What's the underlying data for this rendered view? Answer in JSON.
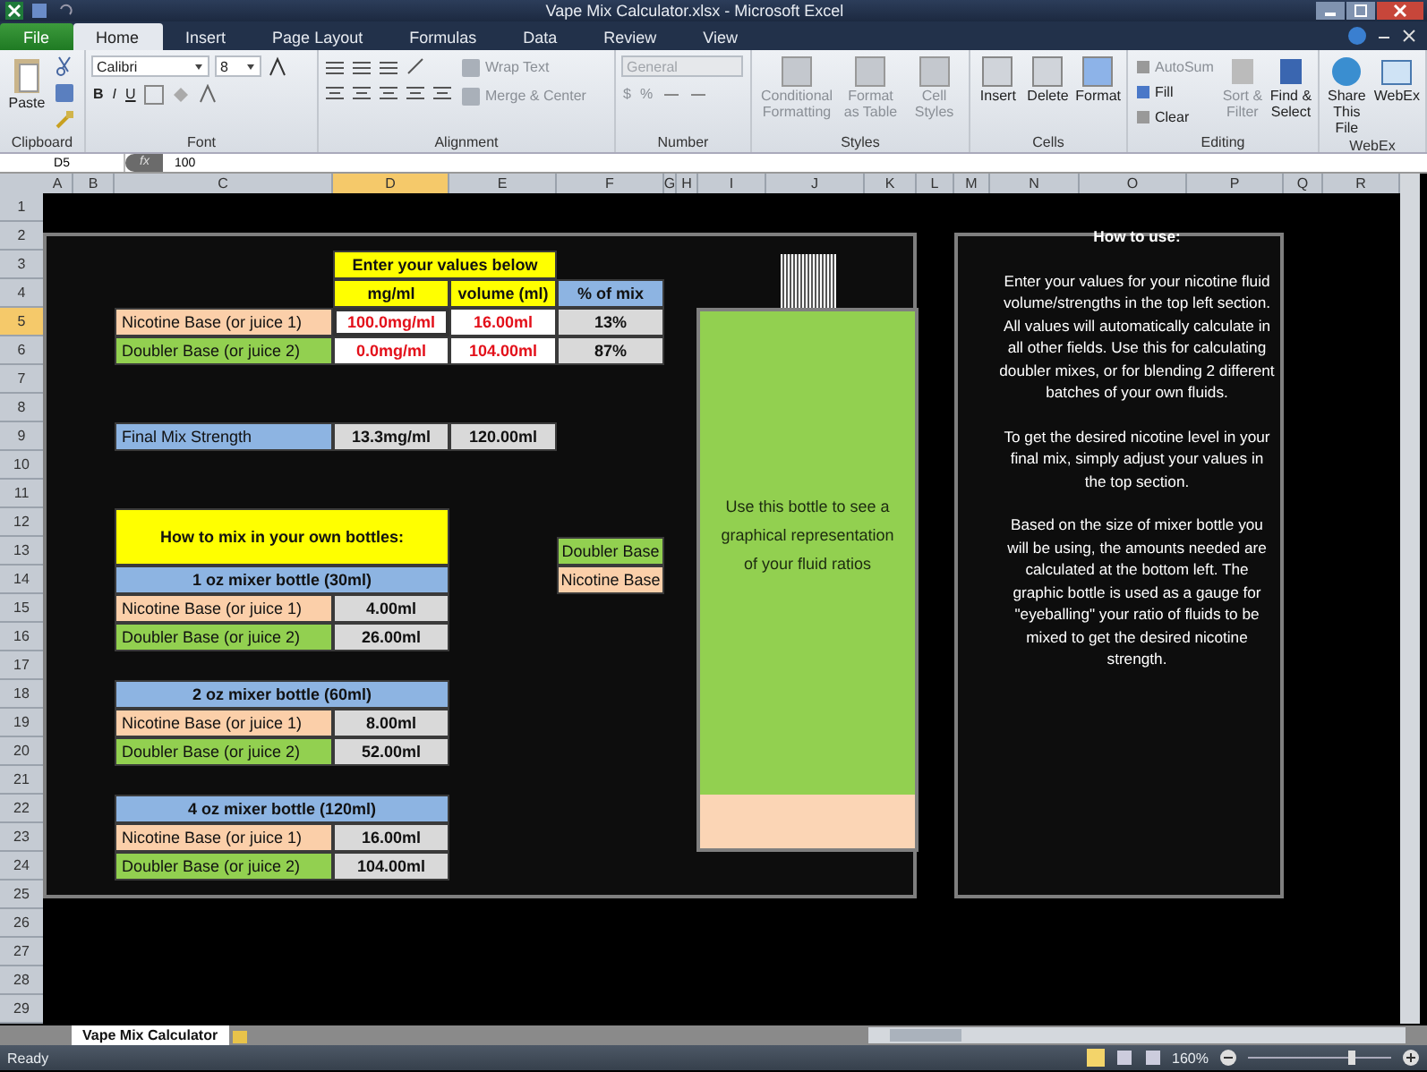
{
  "window": {
    "title": "Vape Mix Calculator.xlsx - Microsoft Excel"
  },
  "tabs": [
    {
      "label": "File",
      "kind": "file",
      "selected": false
    },
    {
      "label": "Home",
      "kind": "tab",
      "selected": true
    },
    {
      "label": "Insert",
      "kind": "tab",
      "selected": false
    },
    {
      "label": "Page Layout",
      "kind": "tab",
      "selected": false
    },
    {
      "label": "Formulas",
      "kind": "tab",
      "selected": false
    },
    {
      "label": "Data",
      "kind": "tab",
      "selected": false
    },
    {
      "label": "Review",
      "kind": "tab",
      "selected": false
    },
    {
      "label": "View",
      "kind": "tab",
      "selected": false
    }
  ],
  "ribbon": {
    "clipboard": {
      "label": "Clipboard",
      "paste": "Paste"
    },
    "font": {
      "label": "Font",
      "family": "Calibri",
      "size": "8",
      "styles": [
        "B",
        "I",
        "U"
      ]
    },
    "alignment": {
      "label": "Alignment",
      "wrap": "Wrap Text",
      "merge": "Merge & Center"
    },
    "number": {
      "label": "Number",
      "format": "General",
      "symbols": [
        "$",
        "%"
      ],
      "disabled": true
    },
    "styles": {
      "label": "Styles",
      "buttons": [
        "Conditional Formatting",
        "Format as Table",
        "Cell Styles"
      ]
    },
    "cells": {
      "label": "Cells",
      "buttons": [
        "Insert",
        "Delete",
        "Format"
      ]
    },
    "editing": {
      "label": "Editing",
      "small": [
        "AutoSum",
        "Fill",
        "Clear"
      ],
      "big": [
        "Sort & Filter",
        "Find & Select"
      ]
    },
    "webex": {
      "label": "WebEx",
      "buttons": [
        "Share This File",
        "WebEx"
      ]
    }
  },
  "formula_bar": {
    "name_box": "D5",
    "fx": "fx",
    "value": "100"
  },
  "columns": [
    "A",
    "B",
    "C",
    "D",
    "E",
    "F",
    "G",
    "H",
    "I",
    "J",
    "K",
    "L",
    "M",
    "N",
    "O",
    "P",
    "Q",
    "R"
  ],
  "rows": [
    "1",
    "2",
    "3",
    "4",
    "5",
    "6",
    "7",
    "8",
    "9",
    "10",
    "11",
    "12",
    "13",
    "14",
    "15",
    "16",
    "17",
    "18",
    "19",
    "20",
    "21",
    "22",
    "23",
    "24",
    "25",
    "26",
    "27",
    "28",
    "29"
  ],
  "input_table": {
    "title": "Enter your values below",
    "headers": [
      "mg/ml",
      "volume (ml)",
      "% of mix"
    ],
    "rows": [
      {
        "label": "Nicotine Base (or juice 1)",
        "kind": "nicotine",
        "mg": "100.0mg/ml",
        "selected": true,
        "volume": "16.00ml",
        "percent": "13%"
      },
      {
        "label": "Doubler Base (or juice 2)",
        "kind": "doubler",
        "mg": "0.0mg/ml",
        "selected": false,
        "volume": "104.00ml",
        "percent": "87%"
      }
    ]
  },
  "final_mix": {
    "label": "Final Mix Strength",
    "strength": "13.3mg/ml",
    "volume": "120.00ml"
  },
  "mixing_guide": {
    "title": "How to mix in your own bottles:",
    "bottles": [
      {
        "title": "1 oz mixer bottle (30ml)",
        "rows": [
          {
            "label": "Nicotine Base (or juice 1)",
            "kind": "nicotine",
            "amount": "4.00ml"
          },
          {
            "label": "Doubler Base (or juice 2)",
            "kind": "doubler",
            "amount": "26.00ml"
          }
        ]
      },
      {
        "title": "2 oz mixer bottle (60ml)",
        "rows": [
          {
            "label": "Nicotine Base (or juice 1)",
            "kind": "nicotine",
            "amount": "8.00ml"
          },
          {
            "label": "Doubler Base (or juice 2)",
            "kind": "doubler",
            "amount": "52.00ml"
          }
        ]
      },
      {
        "title": "4 oz mixer bottle (120ml)",
        "rows": [
          {
            "label": "Nicotine Base (or juice 1)",
            "kind": "nicotine",
            "amount": "16.00ml"
          },
          {
            "label": "Doubler Base (or juice 2)",
            "kind": "doubler",
            "amount": "104.00ml"
          }
        ]
      }
    ]
  },
  "legend": [
    {
      "label": "Doubler Base",
      "kind": "doubler"
    },
    {
      "label": "Nicotine Base",
      "kind": "nicotine"
    }
  ],
  "bottle": {
    "caption": "Use this bottle to see a graphical representation of your fluid ratios",
    "level": 0.1
  },
  "instructions": {
    "title": "How to use:",
    "paragraphs": [
      "Enter your values for your nicotine fluid volume/strengths in the top left section.  All values will automatically calculate in all other fields.  Use this for calculating doubler mixes, or for blending 2 different batches of your own fluids.",
      "To get the desired nicotine level in your  final mix, simply adjust your values in the top section.",
      "Based on the size of mixer bottle you will be using, the amounts needed are calculated at the bottom left.  The graphic bottle is used as a gauge for \"eyeballing\" your ratio of fluids to be mixed to get the desired nicotine strength."
    ]
  },
  "sheet_tabs": [
    {
      "label": "Vape Mix Calculator",
      "selected": true
    }
  ],
  "status_bar": {
    "status": "Ready",
    "zoom": "160%"
  }
}
